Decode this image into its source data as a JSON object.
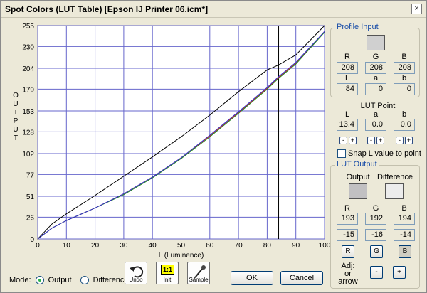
{
  "window": {
    "title": "Spot Colors (LUT Table) [Epson IJ Printer 06.icm*]",
    "close_glyph": "×"
  },
  "chart_data": {
    "type": "line",
    "title": "",
    "xlabel": "L (Luminence)",
    "ylabel": "OUTPUT",
    "x_ticks": [
      0,
      10,
      20,
      30,
      40,
      50,
      60,
      70,
      80,
      90,
      100
    ],
    "y_ticks": [
      0,
      26,
      51,
      77,
      102,
      128,
      153,
      179,
      204,
      230,
      255
    ],
    "xlim": [
      0,
      100
    ],
    "ylim": [
      0,
      255
    ],
    "grid": true,
    "cursor_x": 84,
    "series": [
      {
        "color": "#000000",
        "x": [
          0,
          5,
          10,
          20,
          30,
          40,
          50,
          60,
          70,
          80,
          84,
          90,
          100
        ],
        "y": [
          0,
          18,
          30,
          52,
          75,
          98,
          122,
          148,
          176,
          202,
          208,
          220,
          255
        ]
      },
      {
        "color": "#cc2222",
        "x": [
          0,
          5,
          10,
          20,
          30,
          40,
          50,
          60,
          70,
          80,
          84,
          90,
          100
        ],
        "y": [
          0,
          13,
          22,
          37,
          54,
          74,
          97,
          123,
          151,
          180,
          193,
          210,
          248
        ]
      },
      {
        "color": "#228822",
        "x": [
          0,
          5,
          10,
          20,
          30,
          40,
          50,
          60,
          70,
          80,
          84,
          90,
          100
        ],
        "y": [
          0,
          13,
          22,
          37,
          53,
          73,
          96,
          122,
          150,
          179,
          192,
          209,
          247
        ]
      },
      {
        "color": "#3333cc",
        "x": [
          0,
          5,
          10,
          20,
          30,
          40,
          50,
          60,
          70,
          80,
          84,
          90,
          100
        ],
        "y": [
          0,
          13,
          22,
          37,
          54,
          74,
          97,
          124,
          152,
          181,
          194,
          211,
          248
        ]
      }
    ]
  },
  "footer": {
    "mode_label": "Mode:",
    "mode_output": "Output",
    "mode_difference": "Difference",
    "undo": "Undo",
    "init": "Init",
    "init_icon": "1:1",
    "sample": "Sample",
    "ok": "OK",
    "cancel": "Cancel"
  },
  "profile_input": {
    "title": "Profile Input",
    "swatch_color": "#d0d0d0",
    "labels": [
      "R",
      "G",
      "B",
      "L",
      "a",
      "b"
    ],
    "values": [
      "208",
      "208",
      "208",
      "84",
      "0",
      "0"
    ]
  },
  "lut_point": {
    "title": "LUT Point",
    "labels": [
      "L",
      "a",
      "b"
    ],
    "values": [
      "13.4",
      "0.0",
      "0.0"
    ],
    "minus": "-",
    "plus": "+",
    "snap_label": "Snap L value to point"
  },
  "lut_output": {
    "title": "LUT Output",
    "output_label": "Output",
    "difference_label": "Difference",
    "output_color": "#c1c0c2",
    "difference_color": "#ececec",
    "labels": [
      "R",
      "G",
      "B"
    ],
    "values": [
      "193",
      "192",
      "194"
    ],
    "differences": [
      "-15",
      "-16",
      "-14"
    ],
    "btn_r": "R",
    "btn_g": "G",
    "btn_b": "B",
    "adj_label_1": "Adj:",
    "adj_label_2": "or arrow",
    "minus": "-",
    "plus": "+"
  }
}
